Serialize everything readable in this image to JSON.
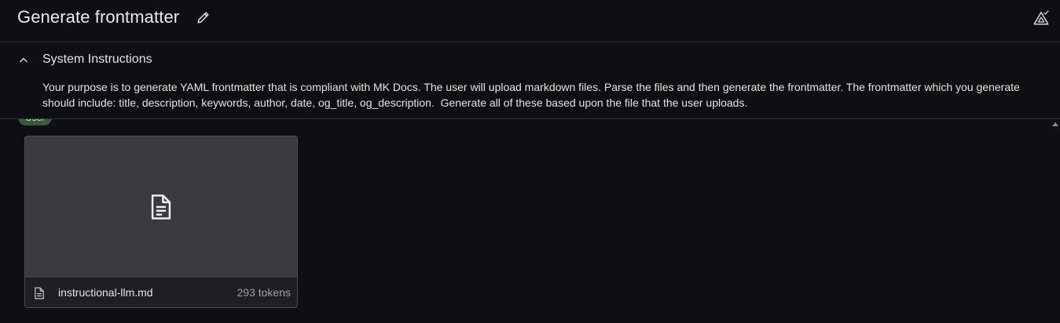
{
  "header": {
    "title": "Generate frontmatter",
    "edit_icon": "pencil-icon",
    "compare_icon": "compare-icon"
  },
  "system_instructions": {
    "title": "System Instructions",
    "collapse_icon": "chevron-up-icon",
    "text": "Your purpose is to generate YAML frontmatter that is compliant with MK Docs. The user will upload markdown files. Parse the files and then generate the frontmatter. The frontmatter which you generate should include: title, description, keywords, author, date, og_title, og_description.  Generate all of these based upon the file that the user uploads."
  },
  "chat": {
    "role_label": "User",
    "attachment": {
      "file_name": "instructional-llm.md",
      "tokens": "293 tokens",
      "icon": "document-icon"
    }
  },
  "colors": {
    "background": "#0e0f12",
    "divider": "#2e3033",
    "preview": "#3a3b3f",
    "role_chip": "#3c5a40"
  }
}
